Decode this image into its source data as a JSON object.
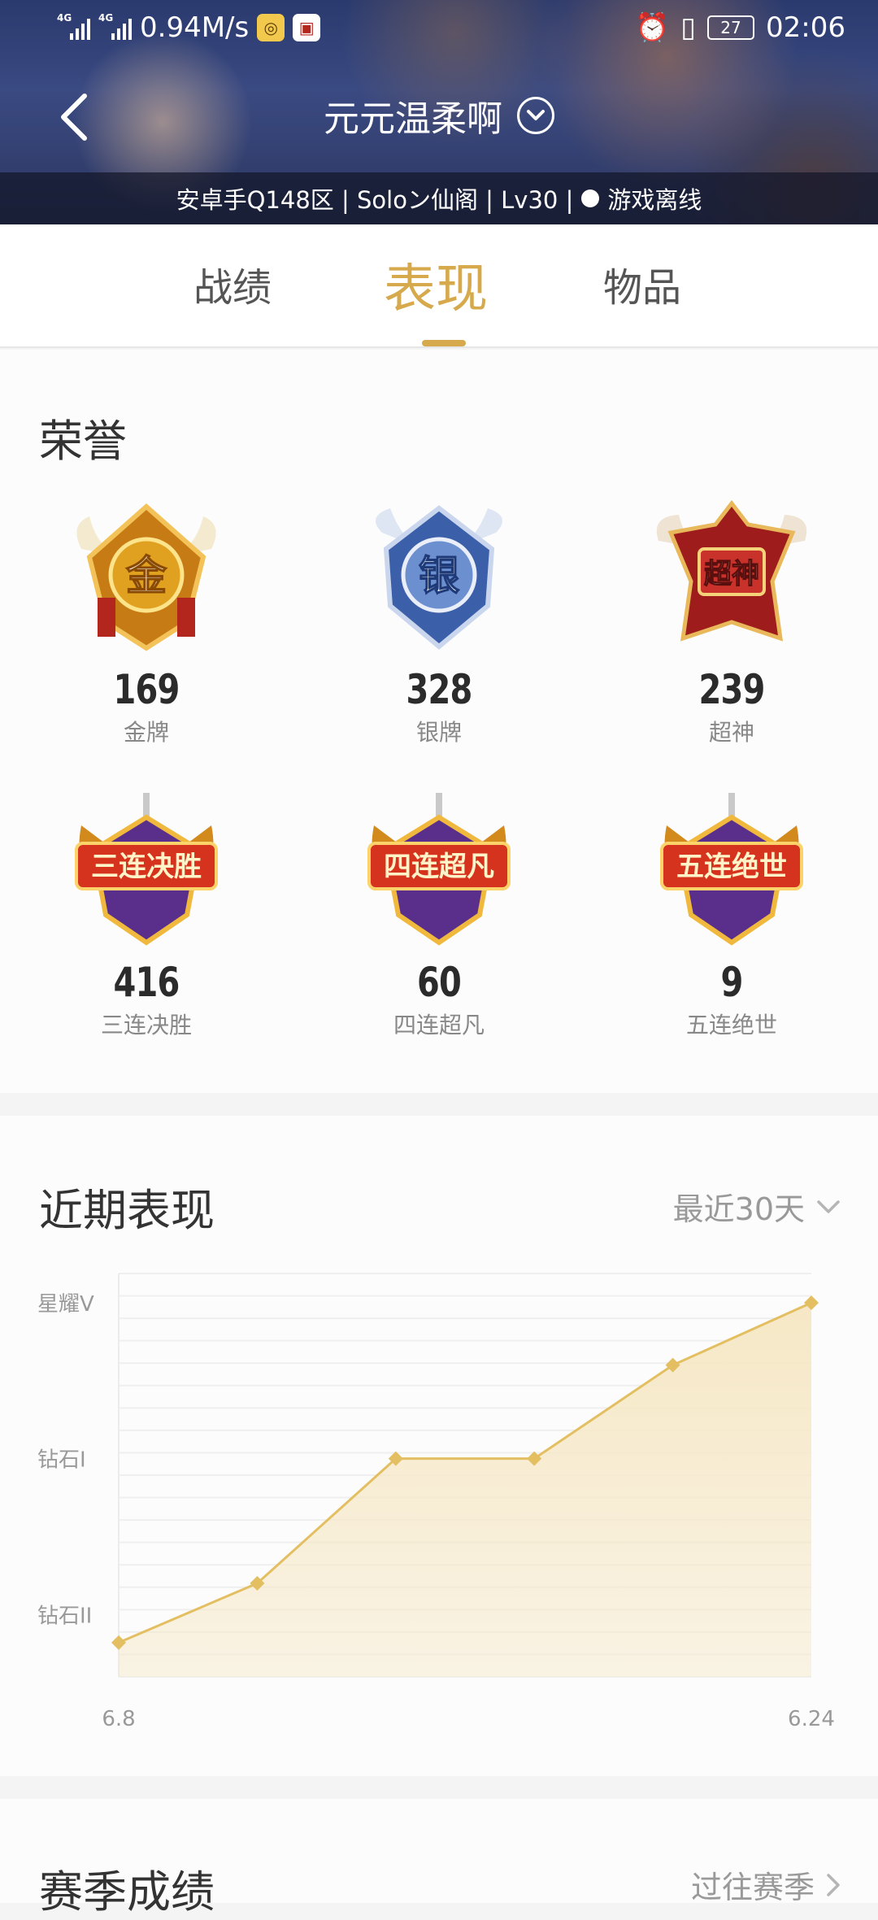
{
  "status_bar": {
    "net1": "4G",
    "net2": "4G",
    "speed": "0.94M/s",
    "battery": "27",
    "time": "02:06",
    "icons": [
      "signal-icon",
      "signal-icon",
      "app-icon",
      "app-icon",
      "alarm-icon",
      "vibrate-icon",
      "battery-icon"
    ]
  },
  "header": {
    "player_name": "元元温柔啊",
    "info": "安卓手Q148区 | Soloン仙阁 | Lv30 |",
    "status": "游戏离线"
  },
  "tabs": [
    {
      "label": "战绩",
      "active": false
    },
    {
      "label": "表现",
      "active": true
    },
    {
      "label": "物品",
      "active": false
    }
  ],
  "honors": {
    "title": "荣誉",
    "items": [
      {
        "badge": "金",
        "count": "169",
        "label": "金牌"
      },
      {
        "badge": "银",
        "count": "328",
        "label": "银牌"
      },
      {
        "badge": "超神",
        "count": "239",
        "label": "超神"
      },
      {
        "badge": "三连决胜",
        "count": "416",
        "label": "三连决胜"
      },
      {
        "badge": "四连超凡",
        "count": "60",
        "label": "四连超凡"
      },
      {
        "badge": "五连绝世",
        "count": "9",
        "label": "五连绝世"
      }
    ]
  },
  "performance": {
    "title": "近期表现",
    "range": "最近30天"
  },
  "chart_data": {
    "type": "area",
    "x_start_label": "6.8",
    "x_end_label": "6.24",
    "y_tick_labels": [
      "钻石II",
      "钻石I",
      "星耀V"
    ],
    "y_tick_values": [
      1,
      2,
      3
    ],
    "values": [
      0.82,
      1.2,
      2.0,
      2.0,
      2.6,
      3.0
    ],
    "ylim": [
      0.6,
      3.0
    ],
    "grid": true
  },
  "season": {
    "title": "赛季成绩",
    "link": "过往赛季"
  },
  "colors": {
    "accent": "#d6a94d",
    "line": "#e3bf62",
    "area": "#f6e8c6"
  }
}
